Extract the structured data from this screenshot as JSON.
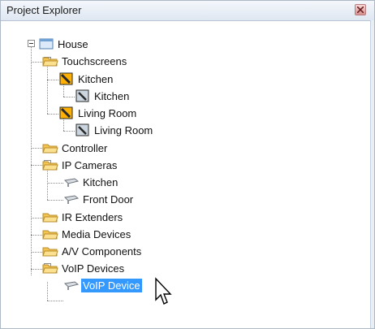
{
  "window": {
    "title": "Project Explorer"
  },
  "tree": {
    "root": "House",
    "touchscreens": "Touchscreens",
    "ts_kitchen_group": "Kitchen",
    "ts_kitchen_device": "Kitchen",
    "ts_living_group": "Living Room",
    "ts_living_device": "Living Room",
    "controller": "Controller",
    "ip_cameras": "IP Cameras",
    "cam_kitchen": "Kitchen",
    "cam_front_door": "Front Door",
    "ir_extenders": "IR Extenders",
    "media_devices": "Media Devices",
    "av_components": "A/V Components",
    "voip_devices": "VoIP Devices",
    "voip_device": "VoIP Device"
  },
  "colors": {
    "selection": "#3399ff",
    "folder": "#f3c452"
  }
}
